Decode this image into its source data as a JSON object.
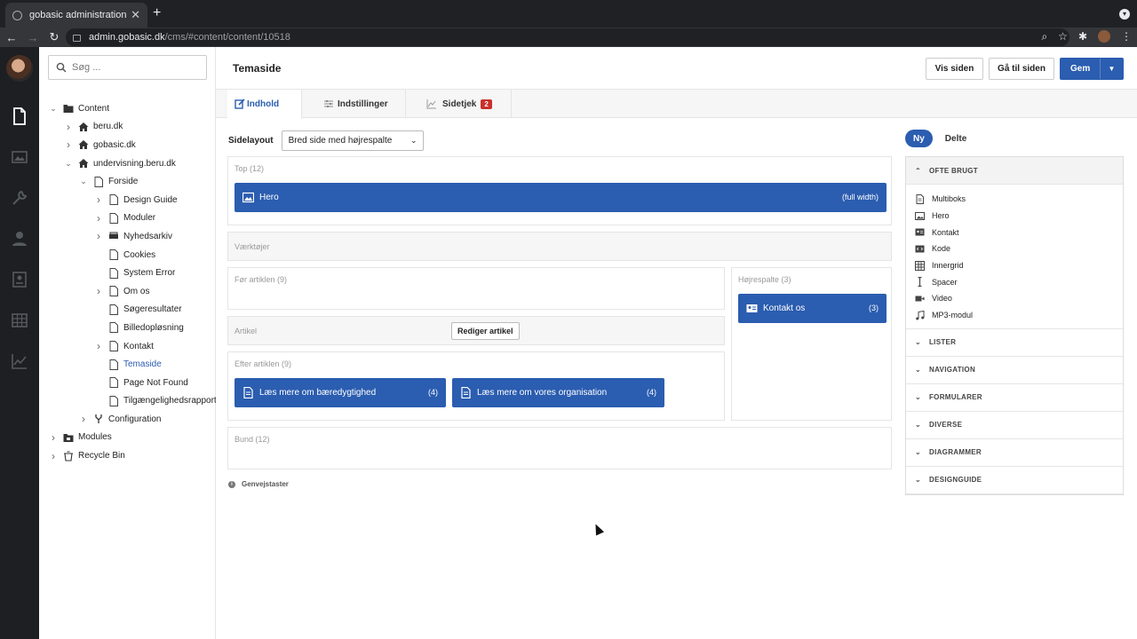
{
  "browser": {
    "tab_title": "gobasic administration",
    "url_host": "admin.gobasic.dk",
    "url_path": "/cms/#content/content/10518"
  },
  "tree": {
    "search_placeholder": "Søg ...",
    "nodes": [
      {
        "label": "Content",
        "icon": "folder-icon",
        "level": 0,
        "chevron": "down"
      },
      {
        "label": "beru.dk",
        "icon": "home-icon",
        "level": 1,
        "chevron": "right"
      },
      {
        "label": "gobasic.dk",
        "icon": "home-icon",
        "level": 1,
        "chevron": "right"
      },
      {
        "label": "undervisning.beru.dk",
        "icon": "home-icon",
        "level": 1,
        "chevron": "down"
      },
      {
        "label": "Forside",
        "icon": "page-icon",
        "level": 2,
        "chevron": "down"
      },
      {
        "label": "Design Guide",
        "icon": "page-icon",
        "level": 3,
        "chevron": "right"
      },
      {
        "label": "Moduler",
        "icon": "page-icon",
        "level": 3,
        "chevron": "right"
      },
      {
        "label": "Nyhedsarkiv",
        "icon": "archive-icon",
        "level": 3,
        "chevron": "right"
      },
      {
        "label": "Cookies",
        "icon": "page-icon",
        "level": 3,
        "chevron": ""
      },
      {
        "label": "System Error",
        "icon": "page-icon",
        "level": 3,
        "chevron": ""
      },
      {
        "label": "Om os",
        "icon": "page-icon",
        "level": 3,
        "chevron": "right"
      },
      {
        "label": "Søgeresultater",
        "icon": "page-icon",
        "level": 3,
        "chevron": ""
      },
      {
        "label": "Billedopløsning",
        "icon": "page-icon",
        "level": 3,
        "chevron": ""
      },
      {
        "label": "Kontakt",
        "icon": "page-icon",
        "level": 3,
        "chevron": "right"
      },
      {
        "label": "Temaside",
        "icon": "page-icon",
        "level": 3,
        "chevron": "",
        "active": true
      },
      {
        "label": "Page Not Found",
        "icon": "page-icon",
        "level": 3,
        "chevron": ""
      },
      {
        "label": "Tilgængelighedsrapport",
        "icon": "page-icon",
        "level": 3,
        "chevron": ""
      },
      {
        "label": "Configuration",
        "icon": "fork-icon",
        "level": 2,
        "chevron": "right"
      },
      {
        "label": "Modules",
        "icon": "modules-icon",
        "level": 0,
        "chevron": "right"
      },
      {
        "label": "Recycle Bin",
        "icon": "trash-icon",
        "level": 0,
        "chevron": "right"
      }
    ]
  },
  "header": {
    "title": "Temaside",
    "view_label": "Vis siden",
    "goto_label": "Gå til siden",
    "save_label": "Gem"
  },
  "tabs": {
    "content": "Indhold",
    "settings": "Indstillinger",
    "check": "Sidetjek",
    "check_badge": "2"
  },
  "layout": {
    "label": "Sidelayout",
    "value": "Bred side med højrespalte"
  },
  "zones": {
    "top": {
      "title": "Top (12)",
      "block_label": "Hero",
      "block_note": "(full width)"
    },
    "tools": {
      "title": "Værktøjer"
    },
    "before": {
      "title": "Før artiklen (9)"
    },
    "article": {
      "title": "Artikel",
      "edit_label": "Rediger artikel"
    },
    "after": {
      "title": "Efter artiklen (9)",
      "blocks": [
        {
          "label": "Læs mere om bæredygtighed",
          "count": "(4)"
        },
        {
          "label": "Læs mere om vores organisation",
          "count": "(4)"
        }
      ]
    },
    "right": {
      "title": "Højrespalte (3)",
      "block_label": "Kontakt os",
      "block_count": "(3)"
    },
    "bottom": {
      "title": "Bund (12)"
    }
  },
  "shortcuts_label": "Genvejstaster",
  "palette": {
    "toggle_new": "Ny",
    "toggle_shared": "Delte",
    "sections": [
      "OFTE BRUGT",
      "LISTER",
      "NAVIGATION",
      "FORMULARER",
      "DIVERSE",
      "DIAGRAMMER",
      "DESIGNGUIDE"
    ],
    "items": [
      {
        "label": "Multiboks",
        "icon": "document-icon"
      },
      {
        "label": "Hero",
        "icon": "image-icon"
      },
      {
        "label": "Kontakt",
        "icon": "contact-card-icon"
      },
      {
        "label": "Kode",
        "icon": "code-icon"
      },
      {
        "label": "Innergrid",
        "icon": "grid-icon"
      },
      {
        "label": "Spacer",
        "icon": "spacer-icon"
      },
      {
        "label": "Video",
        "icon": "video-icon"
      },
      {
        "label": "MP3-modul",
        "icon": "music-icon"
      }
    ]
  },
  "colors": {
    "accent": "#2b5db0",
    "rail": "#1d1f22",
    "badge": "#c9302c"
  }
}
